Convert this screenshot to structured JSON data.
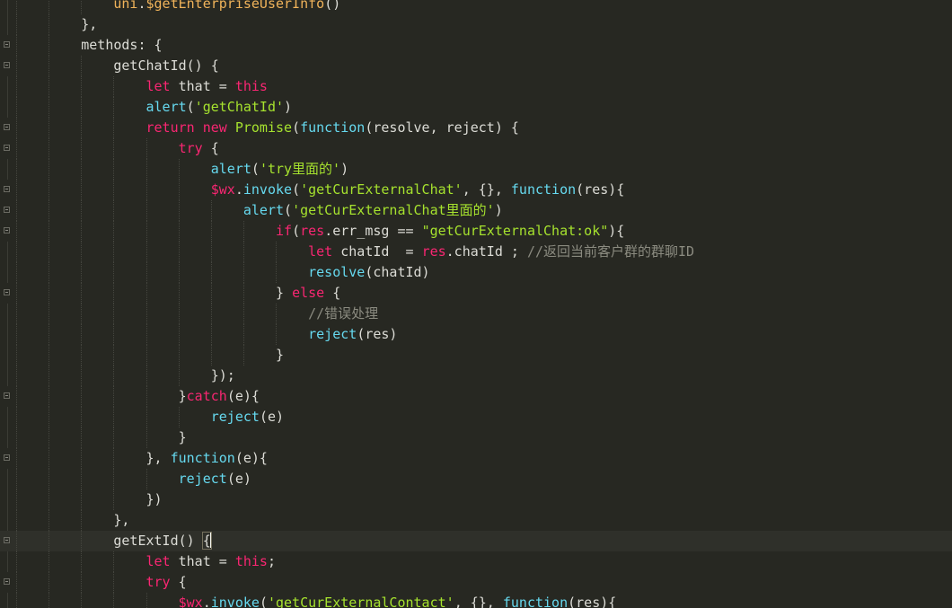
{
  "theme": {
    "background": "#272822",
    "current_line": "#2f302a",
    "plain": "#dcdcd6",
    "keyword": "#f92672",
    "function": "#66d9ef",
    "string": "#a6e22e",
    "comment": "#8b8b80"
  },
  "editor": {
    "lines": [
      {
        "indent": 3,
        "fold": false,
        "tokens": [
          [
            "t-m",
            "uni"
          ],
          [
            "t-p",
            "."
          ],
          [
            "t-m",
            "$getEnterpriseUserInfo"
          ],
          [
            "t-p",
            "()"
          ]
        ]
      },
      {
        "indent": 2,
        "fold": false,
        "tokens": [
          [
            "t-p",
            "},"
          ]
        ]
      },
      {
        "indent": 2,
        "fold": true,
        "tokens": [
          [
            "t-p",
            "methods: {"
          ]
        ]
      },
      {
        "indent": 3,
        "fold": true,
        "tokens": [
          [
            "t-p",
            "getChatId() {"
          ]
        ]
      },
      {
        "indent": 4,
        "fold": false,
        "tokens": [
          [
            "t-k",
            "let"
          ],
          [
            "t-p",
            " that = "
          ],
          [
            "t-k",
            "this"
          ]
        ]
      },
      {
        "indent": 4,
        "fold": false,
        "tokens": [
          [
            "t-f",
            "alert"
          ],
          [
            "t-p",
            "("
          ],
          [
            "t-s",
            "'getChatId'"
          ],
          [
            "t-p",
            ")"
          ]
        ]
      },
      {
        "indent": 4,
        "fold": true,
        "tokens": [
          [
            "t-k",
            "return"
          ],
          [
            "t-p",
            " "
          ],
          [
            "t-k",
            "new"
          ],
          [
            "t-p",
            " "
          ],
          [
            "t-cls",
            "Promise"
          ],
          [
            "t-p",
            "("
          ],
          [
            "t-kb",
            "function"
          ],
          [
            "t-p",
            "(resolve, reject) {"
          ]
        ]
      },
      {
        "indent": 5,
        "fold": true,
        "tokens": [
          [
            "t-k",
            "try"
          ],
          [
            "t-p",
            " {"
          ]
        ]
      },
      {
        "indent": 6,
        "fold": false,
        "tokens": [
          [
            "t-f",
            "alert"
          ],
          [
            "t-p",
            "("
          ],
          [
            "t-s",
            "'try里面的'"
          ],
          [
            "t-p",
            ")"
          ]
        ]
      },
      {
        "indent": 6,
        "fold": true,
        "tokens": [
          [
            "t-k",
            "$wx"
          ],
          [
            "t-p",
            "."
          ],
          [
            "t-f",
            "invoke"
          ],
          [
            "t-p",
            "("
          ],
          [
            "t-s",
            "'getCurExternalChat'"
          ],
          [
            "t-p",
            ", {}, "
          ],
          [
            "t-kb",
            "function"
          ],
          [
            "t-p",
            "(res){"
          ]
        ]
      },
      {
        "indent": 7,
        "fold": true,
        "tokens": [
          [
            "t-f",
            "alert"
          ],
          [
            "t-p",
            "("
          ],
          [
            "t-s",
            "'getCurExternalChat里面的'"
          ],
          [
            "t-p",
            ")"
          ]
        ]
      },
      {
        "indent": 8,
        "fold": true,
        "tokens": [
          [
            "t-k",
            "if"
          ],
          [
            "t-p",
            "("
          ],
          [
            "t-k",
            "res"
          ],
          [
            "t-p",
            ".err_msg == "
          ],
          [
            "t-s",
            "\"getCurExternalChat:ok\""
          ],
          [
            "t-p",
            "){"
          ]
        ]
      },
      {
        "indent": 9,
        "fold": false,
        "tokens": [
          [
            "t-k",
            "let"
          ],
          [
            "t-p",
            " chatId  = "
          ],
          [
            "t-k",
            "res"
          ],
          [
            "t-p",
            ".chatId ; "
          ],
          [
            "t-c",
            "//返回当前客户群的群聊ID"
          ]
        ]
      },
      {
        "indent": 9,
        "fold": false,
        "tokens": [
          [
            "t-f",
            "resolve"
          ],
          [
            "t-p",
            "(chatId)"
          ]
        ]
      },
      {
        "indent": 8,
        "fold": true,
        "tokens": [
          [
            "t-p",
            "} "
          ],
          [
            "t-k",
            "else"
          ],
          [
            "t-p",
            " {"
          ]
        ]
      },
      {
        "indent": 9,
        "fold": false,
        "tokens": [
          [
            "t-c",
            "//错误处理"
          ]
        ]
      },
      {
        "indent": 9,
        "fold": false,
        "tokens": [
          [
            "t-f",
            "reject"
          ],
          [
            "t-p",
            "(res)"
          ]
        ]
      },
      {
        "indent": 8,
        "fold": false,
        "tokens": [
          [
            "t-p",
            "}"
          ]
        ]
      },
      {
        "indent": 6,
        "fold": false,
        "tokens": [
          [
            "t-p",
            "});"
          ]
        ]
      },
      {
        "indent": 5,
        "fold": true,
        "tokens": [
          [
            "t-p",
            "}"
          ],
          [
            "t-k",
            "catch"
          ],
          [
            "t-p",
            "(e){"
          ]
        ]
      },
      {
        "indent": 6,
        "fold": false,
        "tokens": [
          [
            "t-f",
            "reject"
          ],
          [
            "t-p",
            "(e)"
          ]
        ]
      },
      {
        "indent": 5,
        "fold": false,
        "tokens": [
          [
            "t-p",
            "}"
          ]
        ]
      },
      {
        "indent": 4,
        "fold": true,
        "tokens": [
          [
            "t-p",
            "}, "
          ],
          [
            "t-kb",
            "function"
          ],
          [
            "t-p",
            "(e){"
          ]
        ]
      },
      {
        "indent": 5,
        "fold": false,
        "tokens": [
          [
            "t-f",
            "reject"
          ],
          [
            "t-p",
            "(e)"
          ]
        ]
      },
      {
        "indent": 4,
        "fold": false,
        "tokens": [
          [
            "t-p",
            "})"
          ]
        ]
      },
      {
        "indent": 3,
        "fold": false,
        "tokens": [
          [
            "t-p",
            "},"
          ]
        ]
      },
      {
        "indent": 3,
        "fold": true,
        "current": true,
        "tokens": [
          [
            "t-p",
            "getExtId() {"
          ]
        ]
      },
      {
        "indent": 4,
        "fold": false,
        "tokens": [
          [
            "t-k",
            "let"
          ],
          [
            "t-p",
            " that = "
          ],
          [
            "t-k",
            "this"
          ],
          [
            "t-p",
            ";"
          ]
        ]
      },
      {
        "indent": 4,
        "fold": true,
        "tokens": [
          [
            "t-k",
            "try"
          ],
          [
            "t-p",
            " {"
          ]
        ]
      },
      {
        "indent": 5,
        "fold": false,
        "tokens": [
          [
            "t-k",
            "$wx"
          ],
          [
            "t-p",
            "."
          ],
          [
            "t-f",
            "invoke"
          ],
          [
            "t-p",
            "("
          ],
          [
            "t-s",
            "'getCurExternalContact'"
          ],
          [
            "t-p",
            ", {}, "
          ],
          [
            "t-kb",
            "function"
          ],
          [
            "t-p",
            "(res){"
          ]
        ]
      }
    ]
  }
}
